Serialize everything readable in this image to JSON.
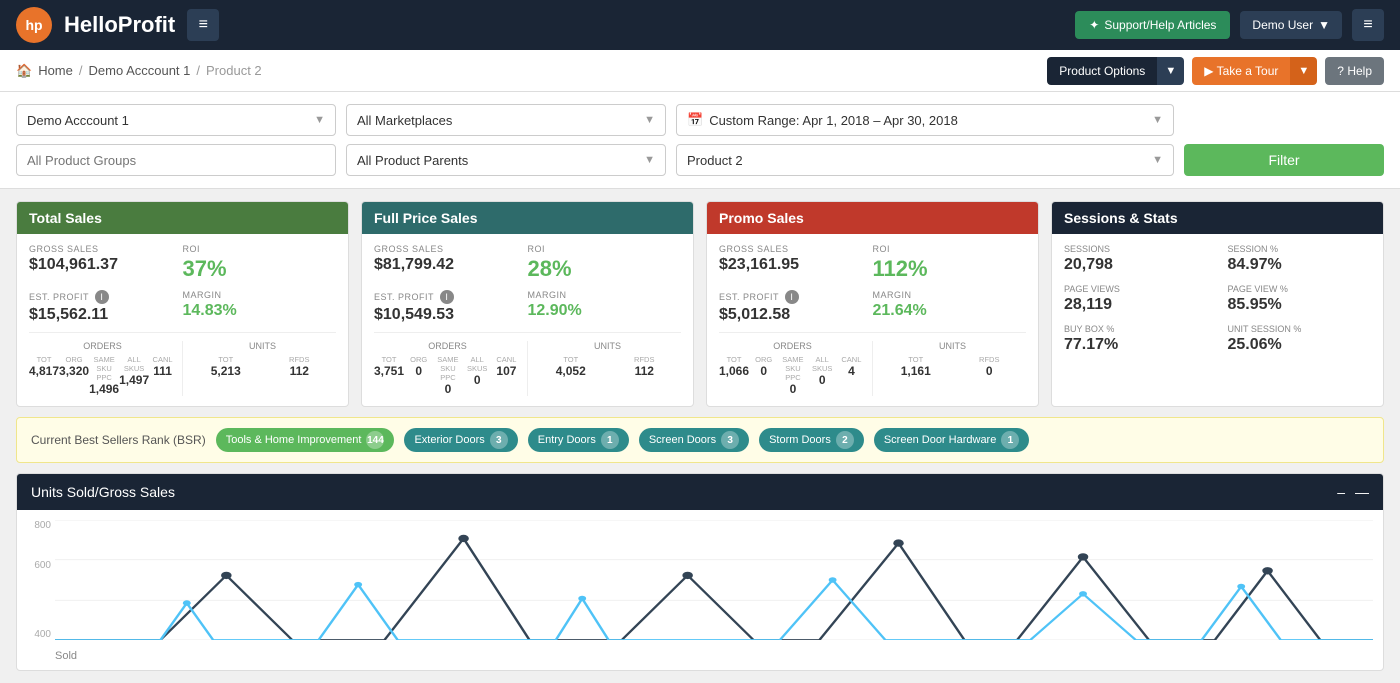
{
  "topNav": {
    "logoLetters": "hp",
    "logoText": "Hello",
    "logoTextBold": "Profit",
    "supportLabel": "Support/Help Articles",
    "demoUserLabel": "Demo User",
    "dropdownArrow": "▼",
    "menuDotsIcon": "≡",
    "hamburgerIcon": "≡"
  },
  "breadcrumb": {
    "homeLabel": "Home",
    "accountLabel": "Demo Acccount 1",
    "currentLabel": "Product 2",
    "productOptionsLabel": "Product Options",
    "takeTourLabel": "Take a Tour",
    "helpLabel": "Help",
    "sep": "/"
  },
  "filters": {
    "account": "Demo Acccount 1",
    "marketplaces": "All Marketplaces",
    "dateRange": "Custom Range: Apr 1, 2018 – Apr 30, 2018",
    "productGroups": "All Product Groups",
    "productParents": "All Product Parents",
    "product": "Product 2",
    "filterButton": "Filter",
    "calendarIcon": "📅"
  },
  "totalSales": {
    "title": "Total Sales",
    "grossSalesLabel": "GROSS SALES",
    "grossSalesValue": "$104,961.37",
    "roiLabel": "ROI",
    "roiValue": "37%",
    "estProfitLabel": "EST. PROFIT",
    "estProfitValue": "$15,562.11",
    "marginLabel": "MARGIN",
    "marginValue": "14.83%",
    "ordersLabel": "ORDERS",
    "unitsLabel": "UNITS",
    "ordersSubs": [
      "TOT",
      "ORG",
      "SAME SKU PPC",
      "ALL SKUS",
      "CANL"
    ],
    "ordersVals": [
      "4,817",
      "3,320",
      "1,496",
      "1,497",
      "111"
    ],
    "unitsSubs": [
      "TOT",
      "RFDS"
    ],
    "unitsVals": [
      "5,213",
      "112"
    ]
  },
  "fullPriceSales": {
    "title": "Full Price Sales",
    "grossSalesLabel": "GROSS SALES",
    "grossSalesValue": "$81,799.42",
    "roiLabel": "ROI",
    "roiValue": "28%",
    "estProfitLabel": "EST. PROFIT",
    "estProfitValue": "$10,549.53",
    "marginLabel": "MARGIN",
    "marginValue": "12.90%",
    "ordersLabel": "ORDERS",
    "unitsLabel": "UNITS",
    "ordersSubs": [
      "TOT",
      "ORG",
      "SAME SKU PPC",
      "ALL SKUS",
      "CANL"
    ],
    "ordersVals": [
      "3,751",
      "0",
      "0",
      "0",
      "107"
    ],
    "unitsSubs": [
      "TOT",
      "RFDS"
    ],
    "unitsVals": [
      "4,052",
      "112"
    ]
  },
  "promoSales": {
    "title": "Promo Sales",
    "grossSalesLabel": "GROSS SALES",
    "grossSalesValue": "$23,161.95",
    "roiLabel": "ROI",
    "roiValue": "112%",
    "estProfitLabel": "EST. PROFIT",
    "estProfitValue": "$5,012.58",
    "marginLabel": "MARGIN",
    "marginValue": "21.64%",
    "ordersLabel": "ORDERS",
    "unitsLabel": "UNITS",
    "ordersSubs": [
      "TOT",
      "ORG",
      "SAME SKU PPC",
      "ALL SKUS",
      "CANL"
    ],
    "ordersVals": [
      "1,066",
      "0",
      "0",
      "0",
      "4"
    ],
    "unitsSubs": [
      "TOT",
      "RFDS"
    ],
    "unitsVals": [
      "1,161",
      "0"
    ]
  },
  "sessionsStats": {
    "title": "Sessions & Stats",
    "items": [
      {
        "label": "SESSIONS",
        "value": "20,798"
      },
      {
        "label": "SESSION %",
        "value": "84.97%"
      },
      {
        "label": "PAGE VIEWS",
        "value": "28,119"
      },
      {
        "label": "PAGE VIEW %",
        "value": "85.95%"
      },
      {
        "label": "BUY BOX %",
        "value": "77.17%"
      },
      {
        "label": "UNIT SESSION %",
        "value": "25.06%"
      }
    ]
  },
  "bsr": {
    "label": "Current Best Sellers Rank (BSR)",
    "tags": [
      {
        "name": "Tools & Home Improvement",
        "count": "144",
        "color": "green"
      },
      {
        "name": "Exterior Doors",
        "count": "3",
        "color": "teal"
      },
      {
        "name": "Entry Doors",
        "count": "1",
        "color": "teal"
      },
      {
        "name": "Screen Doors",
        "count": "3",
        "color": "teal"
      },
      {
        "name": "Storm Doors",
        "count": "2",
        "color": "teal"
      },
      {
        "name": "Screen Door Hardware",
        "count": "1",
        "color": "teal"
      }
    ]
  },
  "chart": {
    "title": "Units Sold/Gross Sales",
    "collapseIcon": "—",
    "minimizeIcon": "–",
    "yLabels": [
      "800",
      "600",
      "",
      "400"
    ],
    "xLabel": "Sold"
  }
}
